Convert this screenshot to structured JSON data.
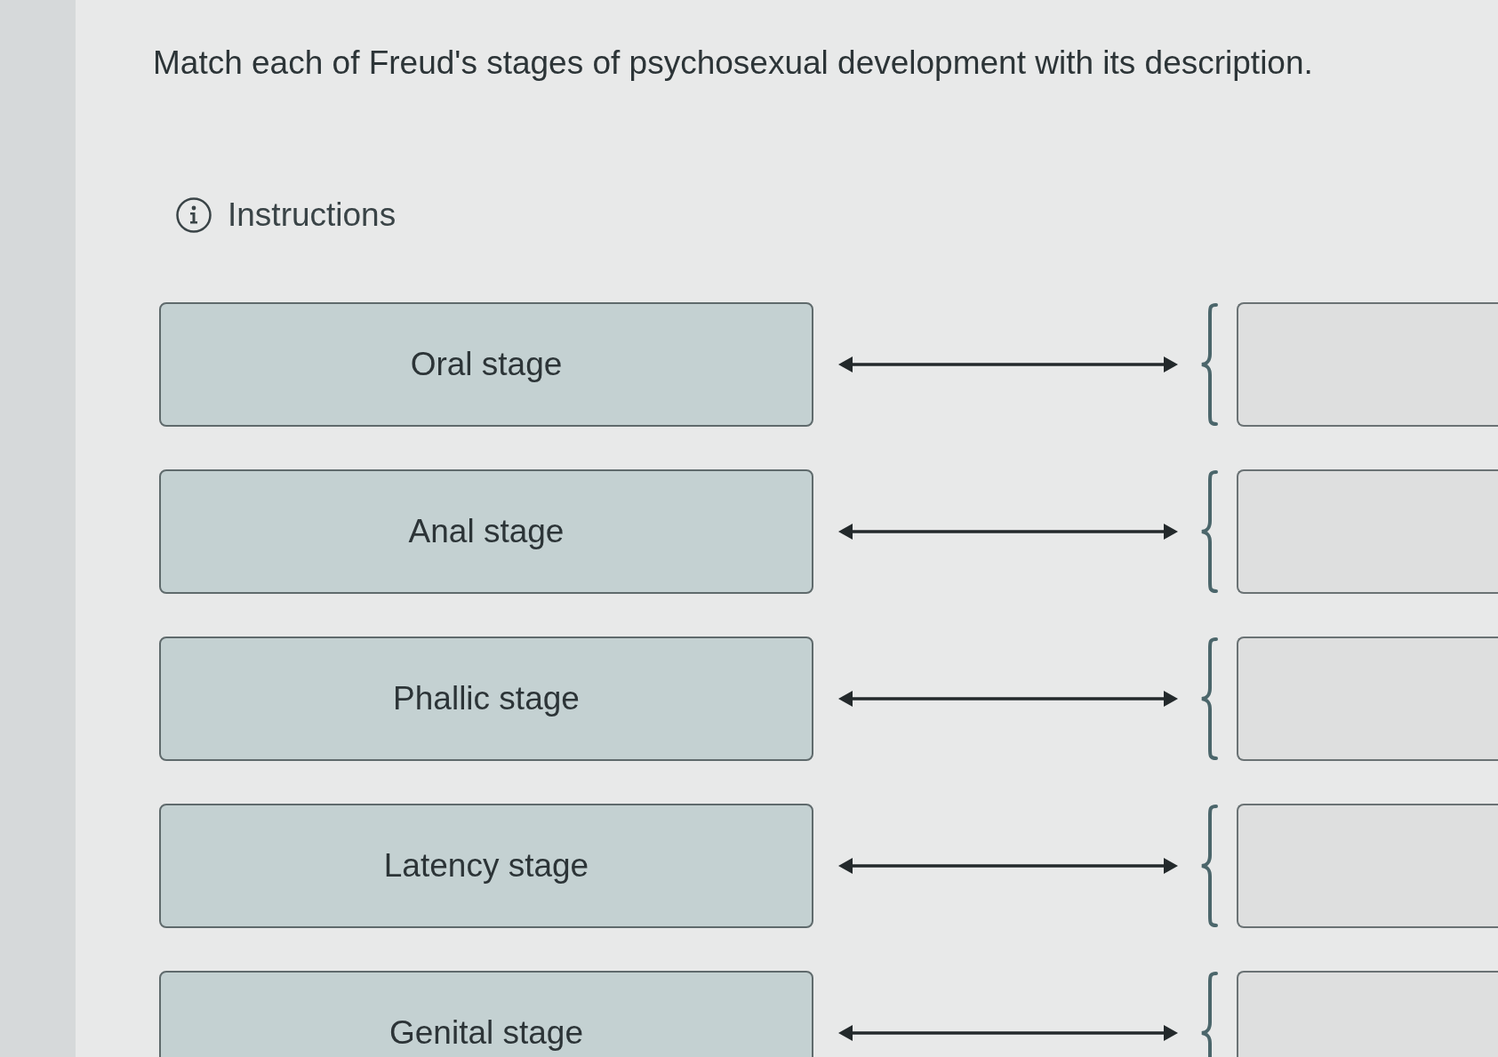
{
  "question": {
    "prompt": "Match each of Freud's stages of psychosexual development with its description."
  },
  "instructions": {
    "label": "Instructions"
  },
  "pairs": [
    {
      "stage": "Oral stage"
    },
    {
      "stage": "Anal stage"
    },
    {
      "stage": "Phallic stage"
    },
    {
      "stage": "Latency stage"
    },
    {
      "stage": "Genital stage"
    }
  ]
}
